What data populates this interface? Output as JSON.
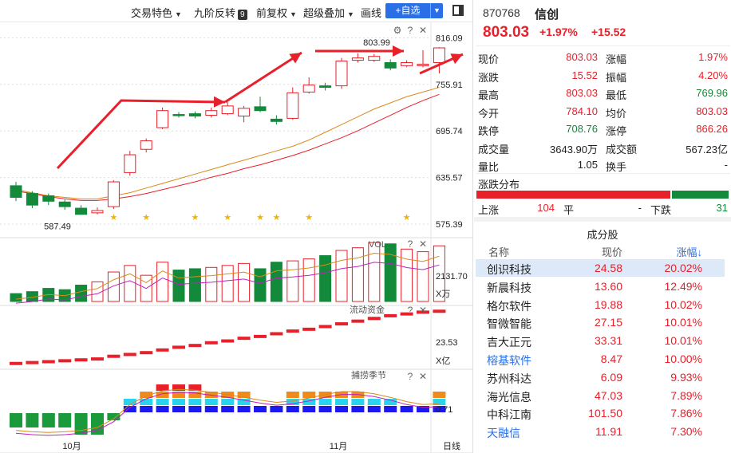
{
  "toolbar": {
    "items": [
      "交易特色",
      "九阶反转",
      "前复权",
      "超级叠加",
      "画线"
    ],
    "badge": "9",
    "add_label": "+自选"
  },
  "chart": {
    "price_ticks": [
      "816.09",
      "755.91",
      "695.74",
      "635.57",
      "575.39"
    ],
    "high_label": "803.99",
    "low_label": "587.49",
    "vol_title": "VOL",
    "vol_value": "2131.70",
    "vol_unit": "X万",
    "flow_title": "流动资金",
    "flow_value": "23.53",
    "flow_unit": "X亿",
    "season_title": "捕捞季节",
    "season_value": "0.71",
    "x_labels": [
      "10月",
      "11月"
    ],
    "period": "日线",
    "candles": [
      {
        "o": 625,
        "c": 610,
        "h": 630,
        "l": 605
      },
      {
        "o": 615,
        "c": 600,
        "h": 618,
        "l": 596
      },
      {
        "o": 612,
        "c": 605,
        "h": 615,
        "l": 600
      },
      {
        "o": 604,
        "c": 598,
        "h": 607,
        "l": 594
      },
      {
        "o": 596,
        "c": 588,
        "h": 600,
        "l": 587.49
      },
      {
        "o": 590,
        "c": 593,
        "h": 597,
        "l": 588
      },
      {
        "o": 598,
        "c": 630,
        "h": 632,
        "l": 595
      },
      {
        "o": 642,
        "c": 665,
        "h": 670,
        "l": 638
      },
      {
        "o": 672,
        "c": 683,
        "h": 686,
        "l": 668
      },
      {
        "o": 700,
        "c": 722,
        "h": 726,
        "l": 698
      },
      {
        "o": 717,
        "c": 716,
        "h": 720,
        "l": 713
      },
      {
        "o": 718,
        "c": 715,
        "h": 721,
        "l": 712
      },
      {
        "o": 716,
        "c": 722,
        "h": 726,
        "l": 713
      },
      {
        "o": 718,
        "c": 728,
        "h": 733,
        "l": 716
      },
      {
        "o": 715,
        "c": 725,
        "h": 728,
        "l": 707
      },
      {
        "o": 727,
        "c": 722,
        "h": 740,
        "l": 720
      },
      {
        "o": 711,
        "c": 708,
        "h": 716,
        "l": 704
      },
      {
        "o": 712,
        "c": 745,
        "h": 752,
        "l": 710
      },
      {
        "o": 746,
        "c": 755,
        "h": 765,
        "l": 744
      },
      {
        "o": 754,
        "c": 752,
        "h": 758,
        "l": 748
      },
      {
        "o": 754,
        "c": 786,
        "h": 790,
        "l": 750
      },
      {
        "o": 787,
        "c": 790,
        "h": 796,
        "l": 784
      },
      {
        "o": 787,
        "c": 792,
        "h": 795,
        "l": 785
      },
      {
        "o": 784,
        "c": 777,
        "h": 788,
        "l": 774
      },
      {
        "o": 780,
        "c": 784,
        "h": 787,
        "l": 778
      },
      {
        "o": 780,
        "c": 782,
        "h": 800,
        "l": 778
      },
      {
        "o": 784,
        "c": 803,
        "h": 803.99,
        "l": 770
      }
    ],
    "ma_orange": [
      620,
      616,
      612,
      610,
      608,
      608,
      612,
      616,
      622,
      628,
      634,
      640,
      646,
      652,
      658,
      664,
      670,
      676,
      684,
      694,
      704,
      714,
      724,
      732,
      740,
      746,
      752
    ],
    "ma_red": [
      618,
      615,
      611,
      608,
      606,
      606,
      608,
      611,
      615,
      620,
      625,
      630,
      636,
      641,
      647,
      652,
      658,
      664,
      671,
      679,
      687,
      696,
      706,
      716,
      726,
      735,
      743
    ],
    "volume": [
      12,
      15,
      20,
      18,
      25,
      30,
      45,
      55,
      40,
      60,
      48,
      50,
      52,
      55,
      58,
      50,
      60,
      62,
      65,
      70,
      78,
      82,
      90,
      88,
      80,
      76,
      85
    ],
    "flow": [
      0.1,
      0.15,
      0.2,
      0.25,
      0.3,
      0.35,
      0.5,
      0.6,
      0.7,
      0.85,
      1.0,
      1.1,
      1.25,
      1.35,
      1.5,
      1.6,
      1.75,
      1.9,
      2.0,
      2.15,
      2.3,
      2.45,
      2.6,
      2.75,
      2.85,
      2.95,
      3.0
    ],
    "season_bars": [
      -2,
      -2,
      -2,
      -2,
      -3,
      -3,
      -1,
      2,
      3,
      4,
      4,
      4,
      3,
      3,
      3,
      1,
      1,
      3,
      3,
      3,
      3,
      3,
      2,
      2,
      1,
      1,
      3
    ],
    "season_line": [
      -2.4,
      -2.6,
      -2.7,
      -2.6,
      -2.4,
      -2.0,
      -0.8,
      1.2,
      2.4,
      3.1,
      3.3,
      3.2,
      2.9,
      2.6,
      2.2,
      1.8,
      1.5,
      1.7,
      2.1,
      2.6,
      3.0,
      3.0,
      2.7,
      2.2,
      1.6,
      1.2,
      1.3
    ]
  },
  "quote": {
    "code": "870768",
    "name": "信创",
    "price": "803.03",
    "change_pct": "+1.97%",
    "change": "+15.52",
    "rows": [
      [
        "现价",
        "803.03",
        "涨幅",
        "1.97%"
      ],
      [
        "涨跌",
        "15.52",
        "振幅",
        "4.20%"
      ],
      [
        "最高",
        "803.03",
        "最低",
        "769.96"
      ],
      [
        "今开",
        "784.10",
        "均价",
        "803.03"
      ],
      [
        "跌停",
        "708.76",
        "涨停",
        "866.26"
      ],
      [
        "成交量",
        "3643.90万",
        "成交额",
        "567.23亿"
      ],
      [
        "量比",
        "1.05",
        "换手",
        "-"
      ]
    ],
    "dist_title": "涨跌分布",
    "dist": {
      "up_label": "上涨",
      "up": "104",
      "flat_label": "平",
      "flat": "-",
      "down_label": "下跌",
      "down": "31",
      "up_ratio": 0.77
    },
    "constituents_title": "成分股",
    "cols": [
      "名称",
      "现价",
      "涨幅↓"
    ],
    "constituents": [
      [
        "创识科技",
        "24.58",
        "20.02%"
      ],
      [
        "新晨科技",
        "13.60",
        "12.49%"
      ],
      [
        "格尔软件",
        "19.88",
        "10.02%"
      ],
      [
        "智微智能",
        "27.15",
        "10.01%"
      ],
      [
        "吉大正元",
        "33.31",
        "10.01%"
      ],
      [
        "榕基软件",
        "8.47",
        "10.00%"
      ],
      [
        "苏州科达",
        "6.09",
        "9.93%"
      ],
      [
        "海光信息",
        "47.03",
        "7.89%"
      ],
      [
        "中科江南",
        "101.50",
        "7.86%"
      ],
      [
        "天融信",
        "11.91",
        "7.30%"
      ]
    ]
  },
  "colors": {
    "up": "#e8202a",
    "down": "#13893a",
    "accent": "#2b6fe6",
    "ma1": "#d98a1a",
    "ma2": "#e8202a"
  }
}
